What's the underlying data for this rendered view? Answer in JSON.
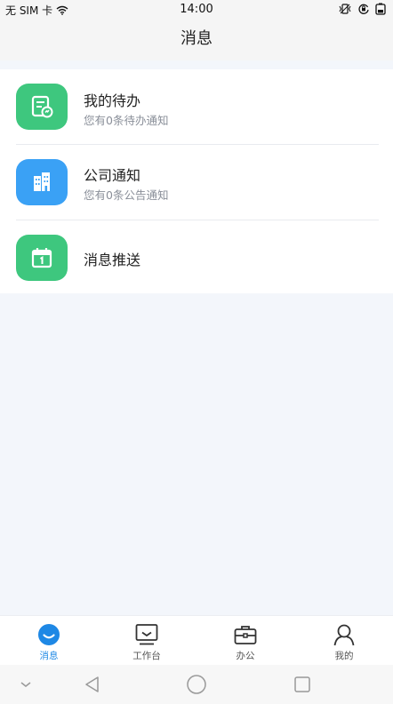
{
  "status_bar": {
    "carrier": "无 SIM 卡",
    "time": "14:00"
  },
  "header": {
    "title": "消息"
  },
  "messages": [
    {
      "title": "我的待办",
      "subtitle": "您有0条待办通知",
      "icon": "todo-icon",
      "color": "#3ec77e"
    },
    {
      "title": "公司通知",
      "subtitle": "您有0条公告通知",
      "icon": "building-icon",
      "color": "#3aa1f5"
    },
    {
      "title": "消息推送",
      "subtitle": "",
      "icon": "calendar-icon",
      "color": "#3ec77e"
    }
  ],
  "tabbar": {
    "active": "消息",
    "accent": "#1e88e5",
    "tabs": [
      {
        "label": "消息",
        "icon": "chat-icon"
      },
      {
        "label": "工作台",
        "icon": "monitor-icon"
      },
      {
        "label": "办公",
        "icon": "briefcase-icon"
      },
      {
        "label": "我的",
        "icon": "person-icon"
      }
    ]
  },
  "system_nav": {
    "buttons": [
      "hide-icon",
      "back-icon",
      "home-icon",
      "recents-icon"
    ]
  }
}
